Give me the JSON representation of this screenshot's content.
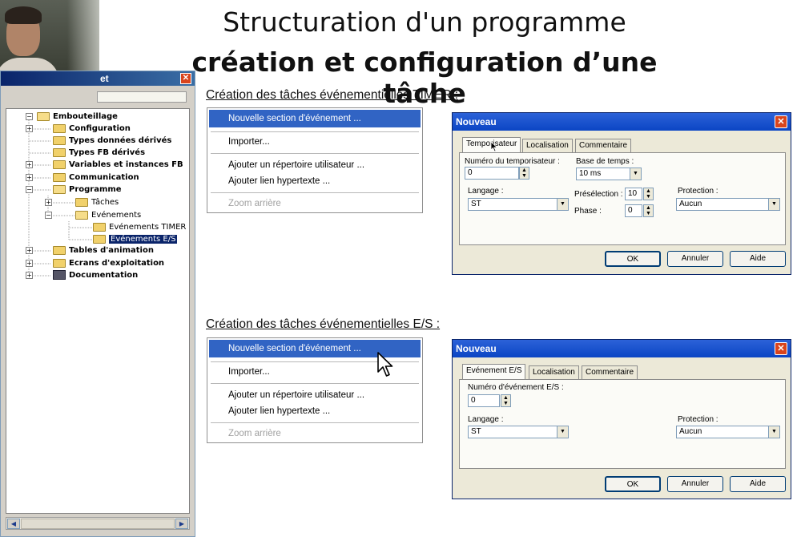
{
  "slide": {
    "title_line1": "Structuration d'un programme",
    "title_line2": "création et configuration d’une tâche"
  },
  "browser": {
    "title_partial": "et",
    "close_glyph": "✕",
    "tree": [
      {
        "label": "Embouteillage",
        "depth": 0,
        "expander": "−",
        "icon": "folder-open"
      },
      {
        "label": "Configuration",
        "depth": 1,
        "expander": "+",
        "icon": "folder"
      },
      {
        "label": "Types données dérivés",
        "depth": 1,
        "expander": "",
        "icon": "folder"
      },
      {
        "label": "Types FB dérivés",
        "depth": 1,
        "expander": "",
        "icon": "folder"
      },
      {
        "label": "Variables et instances FB",
        "depth": 1,
        "expander": "+",
        "icon": "folder"
      },
      {
        "label": "Communication",
        "depth": 1,
        "expander": "+",
        "icon": "folder"
      },
      {
        "label": "Programme",
        "depth": 1,
        "expander": "−",
        "icon": "folder-open"
      },
      {
        "label": "Tâches",
        "depth": 2,
        "expander": "+",
        "icon": "folder"
      },
      {
        "label": "Evénements",
        "depth": 2,
        "expander": "−",
        "icon": "folder-open"
      },
      {
        "label": "Evénements TIMER",
        "depth": 3,
        "expander": "",
        "icon": "folder"
      },
      {
        "label": "Evénements E/S",
        "depth": 3,
        "expander": "",
        "icon": "folder",
        "selected": true
      },
      {
        "label": "Tables d'animation",
        "depth": 1,
        "expander": "+",
        "icon": "folder"
      },
      {
        "label": "Ecrans d'exploitation",
        "depth": 1,
        "expander": "+",
        "icon": "folder"
      },
      {
        "label": "Documentation",
        "depth": 1,
        "expander": "+",
        "icon": "doc"
      }
    ],
    "scroll_left": "◀",
    "scroll_right": "▶"
  },
  "section_timer": {
    "heading": "Création des tâches événementielles TIMER :",
    "menu": {
      "new_section": "Nouvelle section d'événement ...",
      "import": "Importer...",
      "add_user_dir": "Ajouter un répertoire utilisateur ...",
      "add_hyperlink": "Ajouter lien hypertexte ...",
      "zoom_out": "Zoom arrière"
    },
    "dialog": {
      "title": "Nouveau",
      "tabs": [
        "Temporisateur",
        "Localisation",
        "Commentaire"
      ],
      "timer_number_label": "Numéro du temporisateur :",
      "timer_number_value": "0",
      "time_base_label": "Base de temps :",
      "time_base_value": "10 ms",
      "language_label": "Langage :",
      "language_value": "ST",
      "preselection_label": "Présélection :",
      "preselection_value": "10",
      "phase_label": "Phase :",
      "phase_value": "0",
      "protection_label": "Protection :",
      "protection_value": "Aucun",
      "ok": "OK",
      "cancel": "Annuler",
      "help": "Aide"
    }
  },
  "section_io": {
    "heading": "Création des tâches événementielles E/S :",
    "menu": {
      "new_section": "Nouvelle section d'événement ...",
      "import": "Importer...",
      "add_user_dir": "Ajouter un répertoire utilisateur ...",
      "add_hyperlink": "Ajouter lien hypertexte ...",
      "zoom_out": "Zoom arrière"
    },
    "dialog": {
      "title": "Nouveau",
      "tabs": [
        "Evénement E/S",
        "Localisation",
        "Commentaire"
      ],
      "event_number_label": "Numéro d'événement E/S :",
      "event_number_value": "0",
      "language_label": "Langage :",
      "language_value": "ST",
      "protection_label": "Protection :",
      "protection_value": "Aucun",
      "ok": "OK",
      "cancel": "Annuler",
      "help": "Aide"
    }
  },
  "glyphs": {
    "dropdown": "▼",
    "spin_up": "▲",
    "spin_down": "▼",
    "close": "✕"
  }
}
